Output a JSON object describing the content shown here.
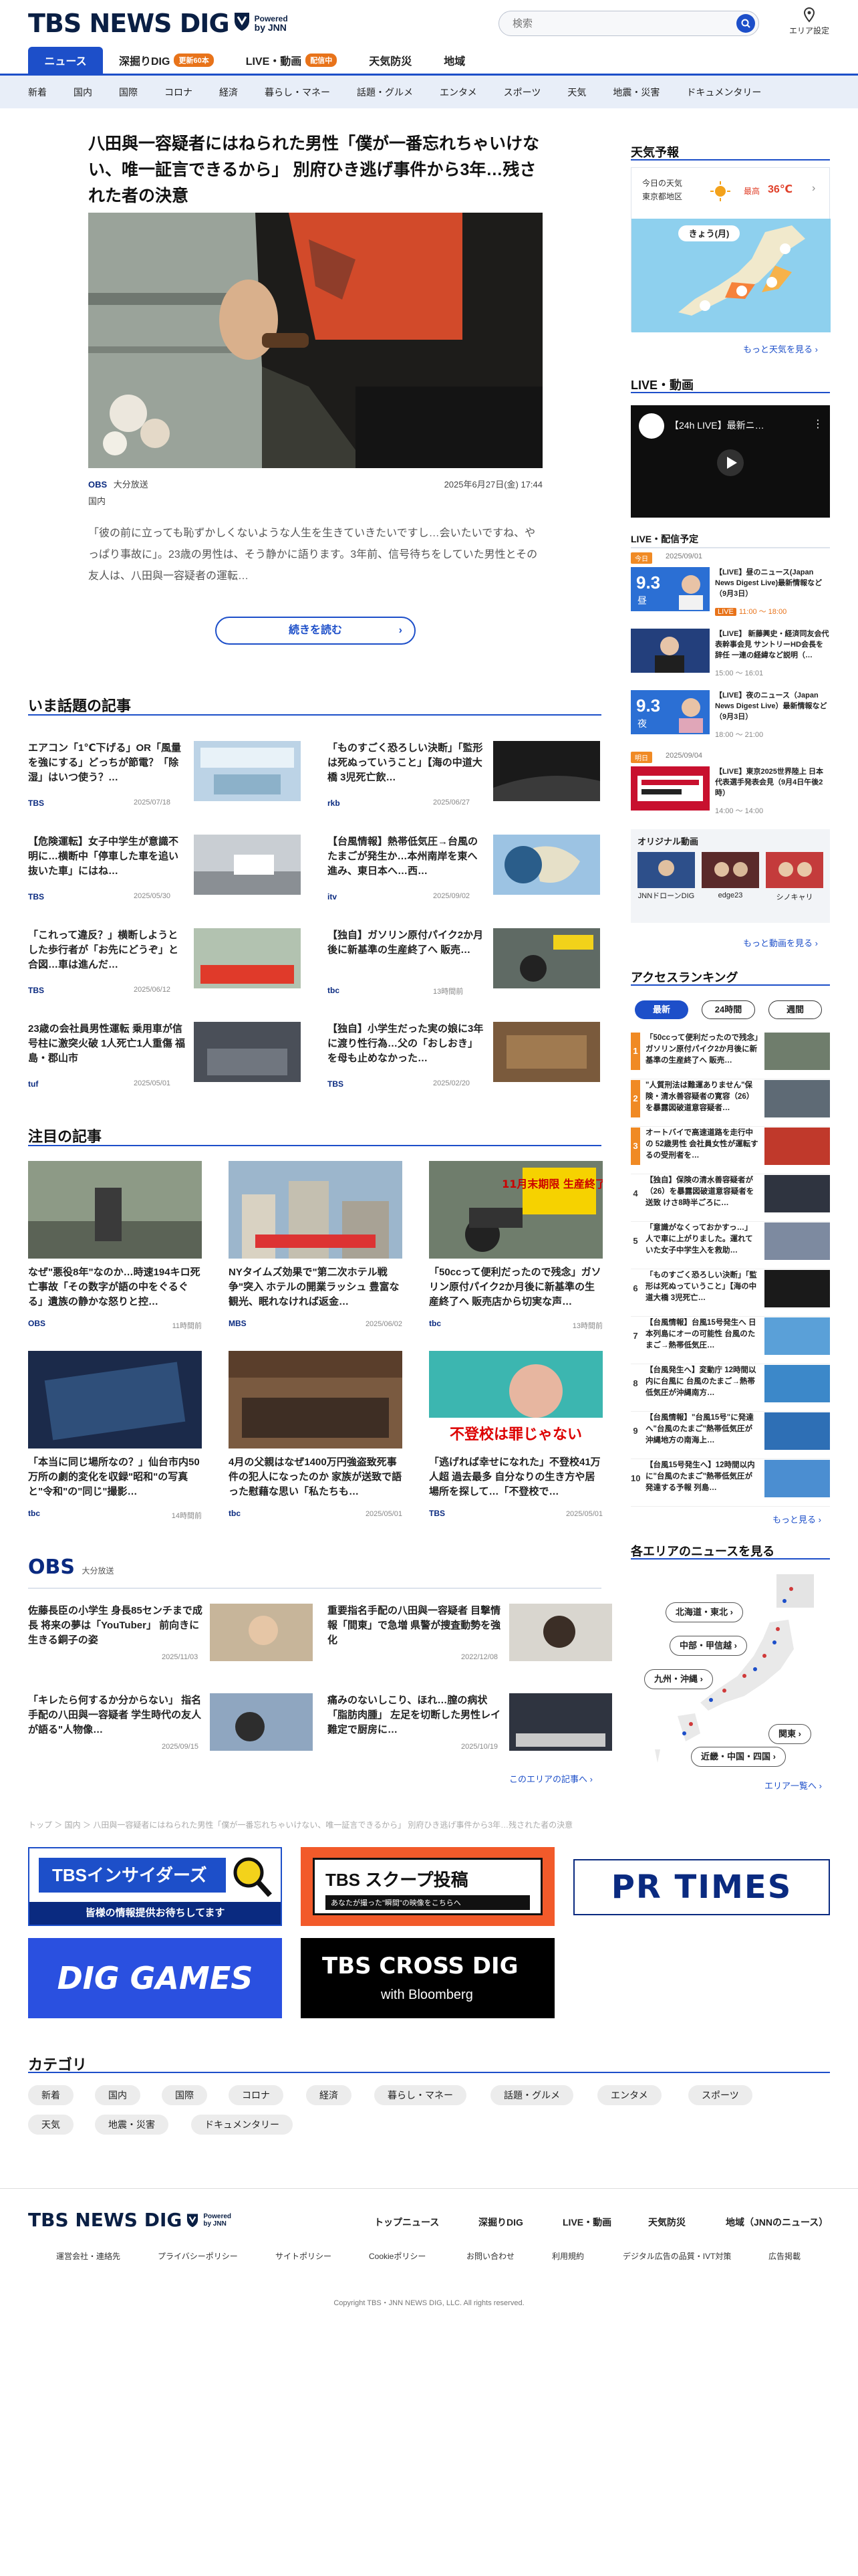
{
  "header": {
    "logo_text": "TBS NEWS DIG",
    "powered_line1": "Powered",
    "powered_line2": "by JNN",
    "search_placeholder": "検索",
    "area_setting_label": "エリア設定"
  },
  "tabs": [
    {
      "label": "ニュース"
    },
    {
      "label": "深掘りDIG",
      "badge": "更新60本"
    },
    {
      "label": "LIVE・動画",
      "badge": "配信中"
    },
    {
      "label": "天気防災"
    },
    {
      "label": "地域"
    }
  ],
  "categories_nav": [
    "新着",
    "国内",
    "国際",
    "コロナ",
    "経済",
    "暮らし・マネー",
    "話題・グルメ",
    "エンタメ",
    "スポーツ",
    "天気",
    "地震・災害",
    "ドキュメンタリー"
  ],
  "hero": {
    "title": "八田與一容疑者にはねられた男性「僕が一番忘れちゃいけない、唯一証言できるから」 別府ひき逃げ事件から3年…残された者の決意",
    "source": "大分放送",
    "category": "国内",
    "date": "2025年6月27日(金) 17:44",
    "excerpt": "「彼の前に立っても恥ずかしくないような人生を生きていきたいですし…会いたいですね、やっぱり事故に」。23歳の男性は、そう静かに語ります。3年前、信号待ちをしていた男性とその友人は、八田與一容疑者の運転…",
    "read_more": "続きを読む"
  },
  "trending": {
    "title": "いま話題の記事",
    "items": [
      {
        "title": "エアコン「1℃下げる」OR「風量を強にする」どっちが節電？「除湿」はいつ使う？…",
        "source": "TBS",
        "date": "2025/07/18"
      },
      {
        "title": "「ものすごく恐ろしい決断」「監形は死ぬっていうこと」【海の中道大橋 3児死亡飲…",
        "source": "rkb",
        "date": "2025/06/27"
      },
      {
        "title": "【危険運転】女子中学生が意識不明に…横断中「停車した車を追い抜いた車」にはね…",
        "source": "TBS",
        "date": "2025/05/30"
      },
      {
        "title": "【台風情報】熱帯低気圧→台風のたまごが発生か…本州南岸を東へ進み、東日本へ…西…",
        "source": "itv",
        "date": "2025/09/02"
      },
      {
        "title": "「これって違反？」横断しようとした歩行者が「お先にどうぞ」と合図…車は進んだ…",
        "source": "TBS",
        "date": "2025/06/12"
      },
      {
        "title": "【独自】ガソリン原付パイク2か月後に新基準の生産終了へ 販売…",
        "source": "tbc",
        "date": "13時間前"
      },
      {
        "title": "23歳の会社員男性運転 乗用車が信号柱に激突火破 1人死亡1人重傷 福島・郡山市",
        "source": "tuf",
        "date": "2025/05/01"
      },
      {
        "title": "【独自】小学生だった実の娘に3年に渡り性行為…父の「おしおき」を母も止めなかった…",
        "source": "TBS",
        "date": "2025/02/20"
      }
    ]
  },
  "featured": {
    "title": "注目の記事",
    "items": [
      {
        "title": "なぜ\"悪役8年\"なのか…時速194キロ死亡事故「その数字が語の中をぐるぐる」遺族の静かな怒りと控…",
        "source": "OBS",
        "date": "11時間前"
      },
      {
        "title": "NYタイムズ効果で\"第二次ホテル戦争\"突入 ホテルの開業ラッシュ 豊富な観光、眠れなければ返金…",
        "source": "MBS",
        "date": "2025/06/02"
      },
      {
        "title": "「50ccって便利だったので残念」ガソリン原付パイク2か月後に新基準の生産終了へ 販売店から切実な声…",
        "source": "tbc",
        "date": "13時間前"
      },
      {
        "title": "「本当に同じ場所なの？」仙台市内50万所の劇的変化を収録\"昭和\"の写真と\"令和\"の\"同じ\"撮影…",
        "source": "tbc",
        "date": "14時間前"
      },
      {
        "title": "4月の父親はなぜ1400万円強盗致死事件の犯人になったのか 家族が送致で語った慰藉な思い「私たちも…",
        "source": "tbc",
        "date": "2025/05/01"
      },
      {
        "title": "「逃げれば幸せになれた」不登校41万人超 過去最多 自分なりの生き方や居場所を探して…「不登校で…",
        "source": "TBS",
        "date": "2025/05/01"
      }
    ],
    "thumb_captions": [
      "",
      "",
      "11月末期限 生産終了へ",
      "",
      "",
      "不登校は罪じゃない"
    ]
  },
  "obs": {
    "logo": "OBS",
    "station": "大分放送",
    "items": [
      {
        "title": "佐藤長臣の小学生 身長85センチまで成長 将来の夢は「YouTuber」 前向きに生きる銅子の姿",
        "date": "2025/11/03"
      },
      {
        "title": "重要指名手配の八田與一容疑者 目撃情報「間東」で急増 県警が捜査動勢を強化",
        "date": "2022/12/08"
      },
      {
        "title": "「キレたら何するか分からない」 指名手配の八田與一容疑者 学生時代の友人が語る\"人物像…",
        "date": "2025/09/15"
      },
      {
        "title": "痛みのないしこり、ほれ…膣の病状「脂肪肉腫」 左足を切断した男性レイ 難定で厨房に…",
        "date": "2025/10/19"
      }
    ],
    "more": "このエリアの記事へ"
  },
  "breadcrumb": "トップ ＞ 国内 ＞ 八田與一容疑者にはねられた男性「僕が一番忘れちゃいけない、唯一証言できるから」 別府ひき逃げ事件から3年…残された者の決意",
  "banners": {
    "insiders_title": "TBSインサイダーズ",
    "insiders_sub": "皆様の情報提供お待ちしてます",
    "scoop_title": "TBS スクープ投稿",
    "scoop_sub": "あなたが撮った\"瞬間\"の映像をこちらへ",
    "prtimes": "PR TIMES",
    "diggames": "DIG GAMES",
    "crossdig_title": "TBS CROSS DIG",
    "crossdig_sub": "with Bloomberg"
  },
  "category_section": {
    "title": "カテゴリ",
    "chips": [
      "新着",
      "国内",
      "国際",
      "コロナ",
      "経済",
      "暮らし・マネー",
      "話題・グルメ",
      "エンタメ",
      "スポーツ",
      "天気",
      "地震・災害",
      "ドキュメンタリー"
    ]
  },
  "weather": {
    "title": "天気予報",
    "today_label": "今日の天気",
    "region": "東京都地区",
    "high_label": "最高",
    "high_temp": "36℃",
    "map_caption": "きょう(月)",
    "more": "もっと天気を見る"
  },
  "live": {
    "title": "LIVE・動画",
    "video_title": "【24h LIVE】最新ニ…",
    "schedule_title": "LIVE・配信予定",
    "schedule": [
      {
        "label": "今日",
        "label_date": "2025/09/01",
        "thumb_text": "9.3",
        "thumb_sub": "昼",
        "title": "【LIVE】昼のニュース(Japan News Digest Live)最新情報など（9月3日）",
        "time_badge": "LIVE",
        "time": "11:00 ～ 18:00"
      },
      {
        "label": "",
        "label_date": "",
        "thumb_text": "",
        "thumb_sub": "",
        "title": "【LIVE】 新藤興史・経済同友会代表幹事会見 サントリーHD会長を辞任 一連の経緯など説明（…",
        "time_badge": "",
        "time": "15:00 ～ 16:01"
      },
      {
        "label": "",
        "label_date": "",
        "thumb_text": "9.3",
        "thumb_sub": "夜",
        "title": "【LIVE】夜のニュース（Japan News Digest Live）最新情報など（9月3日）",
        "time_badge": "",
        "time": "18:00 ～ 21:00"
      },
      {
        "label": "明日",
        "label_date": "2025/09/04",
        "thumb_text": "",
        "thumb_sub": "",
        "title": "【LIVE】東京2025世界陸上 日本代表選手発表会見（9月4日午後2時）",
        "time_badge": "",
        "time": "14:00 ～ 14:00"
      }
    ],
    "original_title": "オリジナル動画",
    "originals": [
      {
        "name": "JNNドローンDIG"
      },
      {
        "name": "edge23"
      },
      {
        "name": "シノキャリ"
      }
    ],
    "more": "もっと動画を見る"
  },
  "ranking": {
    "title": "アクセスランキング",
    "tabs": [
      "最新",
      "24時間",
      "週間"
    ],
    "items": [
      {
        "rank": "1",
        "title": "「50ccって便利だったので残念」ガソリン原付パイク2か月後に新基準の生産終了へ 販売…"
      },
      {
        "rank": "2",
        "title": "\"人質刑法は難運ありません\"保険・清水善容疑者の寛容（26）を暴露図破道意容疑者…"
      },
      {
        "rank": "3",
        "title": "オートバイで高速道路を走行中の 52歳男性 会社員女性が運転するの受刑者を…"
      },
      {
        "rank": "4",
        "title": "【独自】保険の清水善容疑者が（26）を暴露図破道意容疑者を送致 けさ8時半ごろに…"
      },
      {
        "rank": "5",
        "title": "「意識がなくっておかすっ…」人で車に上がりました。運れていた女子中学生入を救助…"
      },
      {
        "rank": "6",
        "title": "「ものすごく恐ろしい決断」「監形は死ぬっていうこと」【海の中道大橋 3児死亡…"
      },
      {
        "rank": "7",
        "title": "【台風情報】台風15号発生へ 日本列島にオーの可能性 台風のたまご→熱帯低気圧…"
      },
      {
        "rank": "8",
        "title": "【台風発生へ】変動庁 12時間以内に台風に 台風のたまご→熱帯低気圧が沖縄南方…"
      },
      {
        "rank": "9",
        "title": "【台風情報】\"台風15号\"に発達へ\"台風のたまご\"熱帯低気圧が沖縄地方の南海上…"
      },
      {
        "rank": "10",
        "title": "【台風15号発生へ】12時間以内に\"台風のたまご\"熱帯低気圧が発達する予報 列島…"
      }
    ],
    "more": "もっと見る"
  },
  "areas": {
    "title": "各エリアのニュースを見る",
    "chips": [
      "北海道・東北",
      "中部・甲信越",
      "九州・沖縄",
      "関東",
      "近畿・中国・四国"
    ],
    "more": "エリア一覧へ"
  },
  "footer": {
    "logo_text": "TBS NEWS DIG",
    "nav": [
      "トップニュース",
      "深掘りDIG",
      "LIVE・動画",
      "天気防災",
      "地域（JNNのニュース）"
    ],
    "sub": [
      "運営会社・連絡先",
      "プライバシーポリシー",
      "サイトポリシー",
      "Cookieポリシー",
      "お問い合わせ",
      "利用規約",
      "デジタル広告の品質・IVT対策",
      "広告掲載"
    ],
    "copyright": "Copyright TBS・JNN NEWS DIG, LLC. All rights reserved."
  },
  "colors": {
    "brand": "#1d4fc9",
    "navy": "#0a1f44",
    "live_orange": "#e8731a",
    "rank_orange": "#f08a24"
  }
}
